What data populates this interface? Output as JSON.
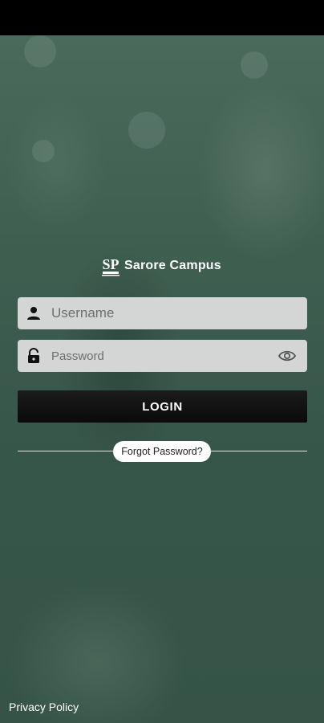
{
  "app": {
    "name": "Sarore Campus",
    "logo_letters": "SP"
  },
  "form": {
    "username_placeholder": "Username",
    "password_placeholder": "Password",
    "login_label": "LOGIN",
    "forgot_label": "Forgot Password?"
  },
  "footer": {
    "privacy_label": "Privacy Policy"
  },
  "icons": {
    "username": "person-icon",
    "password": "lock-icon",
    "visibility": "eye-icon"
  },
  "colors": {
    "background": "#3c5a4d",
    "field": "#d3d6d4",
    "button": "#111111"
  }
}
